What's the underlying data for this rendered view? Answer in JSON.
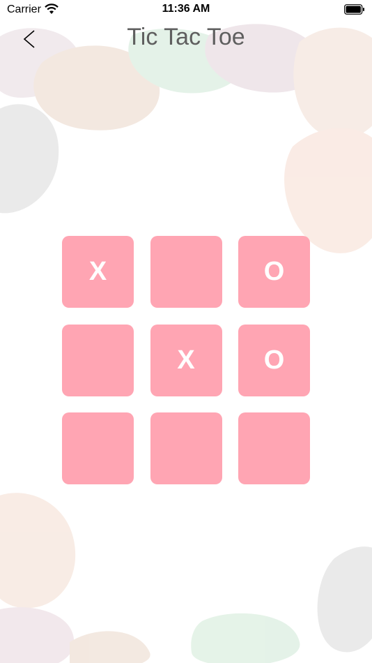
{
  "status_bar": {
    "carrier": "Carrier",
    "time": "11:36 AM"
  },
  "nav": {
    "title": "Tic Tac Toe",
    "back_icon": "chevron-left-icon"
  },
  "board": {
    "cells": [
      "X",
      "",
      "O",
      "",
      "X",
      "O",
      "",
      "",
      ""
    ]
  },
  "colors": {
    "cell": "#ffa5b3",
    "mark": "#ffffff",
    "title": "#5f5f5f"
  }
}
